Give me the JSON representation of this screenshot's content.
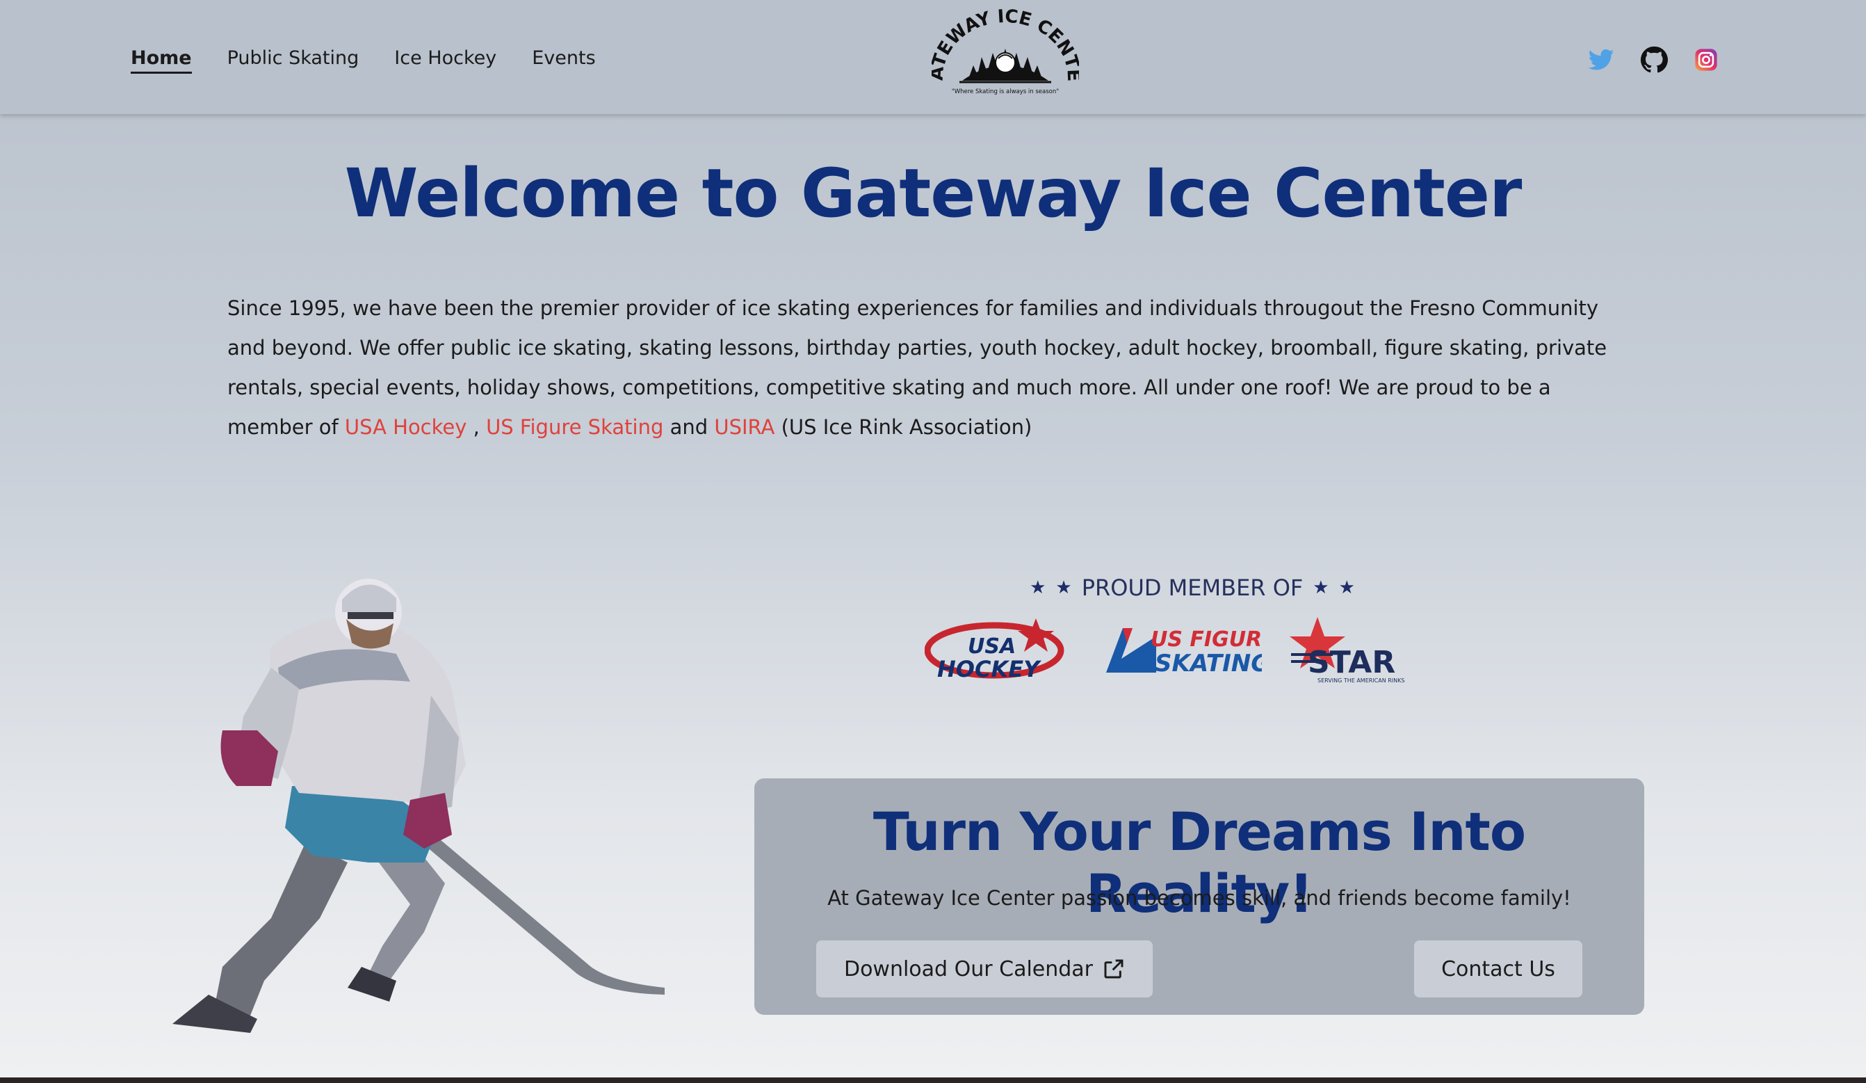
{
  "nav": {
    "links": [
      {
        "label": "Home",
        "active": true
      },
      {
        "label": "Public Skating",
        "active": false
      },
      {
        "label": "Ice Hockey",
        "active": false
      },
      {
        "label": "Events",
        "active": false
      }
    ],
    "logo": {
      "text_top": "GATEWAY ICE CENTER",
      "tagline": "\"Where Skating is always in season\""
    },
    "social": [
      "twitter-icon",
      "github-icon",
      "instagram-icon"
    ]
  },
  "hero": {
    "title": "Welcome to Gateway Ice Center",
    "intro_text": "Since 1995, we have been the premier provider of ice skating experiences for families and individuals througout the Fresno Community and beyond. We offer public ice skating, skating lessons, birthday parties, youth hockey, adult hockey, broomball, figure skating, private rentals, special events, holiday shows, competitions, competitive skating and much more. All under one roof! We are proud to be a member of",
    "link_usa_hockey": "USA Hockey",
    "sep_comma": ",",
    "link_us_figure": "US Figure Skating",
    "sep_and": "and",
    "link_usira": "USIRA",
    "usira_suffix": "(US Ice Rink Association)"
  },
  "members": {
    "heading": "PROUD MEMBER OF",
    "logos": [
      {
        "name": "USA HOCKEY"
      },
      {
        "name": "US FIGURE SKATING"
      },
      {
        "name": "STAR",
        "tagline": "SERVING THE AMERICAN RINKS"
      }
    ]
  },
  "cta": {
    "title": "Turn Your Dreams Into Reality!",
    "subtitle": "At Gateway Ice Center passion becomes skill, and friends become family!",
    "calendar_button": "Download Our Calendar",
    "contact_button": "Contact Us"
  },
  "colors": {
    "brand_blue": "#0f2f7a",
    "link_red": "#e0413b",
    "twitter_blue": "#4fa2e6"
  }
}
